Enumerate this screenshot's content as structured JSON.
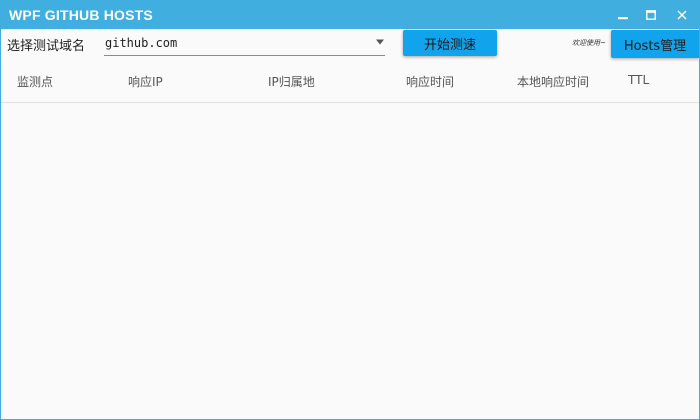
{
  "window": {
    "title": "WPF GITHUB HOSTS",
    "accent_color": "#41aee0",
    "button_color": "#11a3ec",
    "controls": {
      "minimize": "minimize-icon",
      "maximize": "maximize-icon",
      "close": "close-icon"
    }
  },
  "toolbar": {
    "domain_label": "选择测试域名",
    "domain_value": "github.com",
    "start_label": "开始测速",
    "welcome_text": "欢迎使用~",
    "hosts_label": "Hosts管理"
  },
  "table": {
    "columns": [
      "监测点",
      "响应IP",
      "IP归属地",
      "响应时间",
      "本地响应时间",
      "TTL"
    ],
    "rows": []
  }
}
